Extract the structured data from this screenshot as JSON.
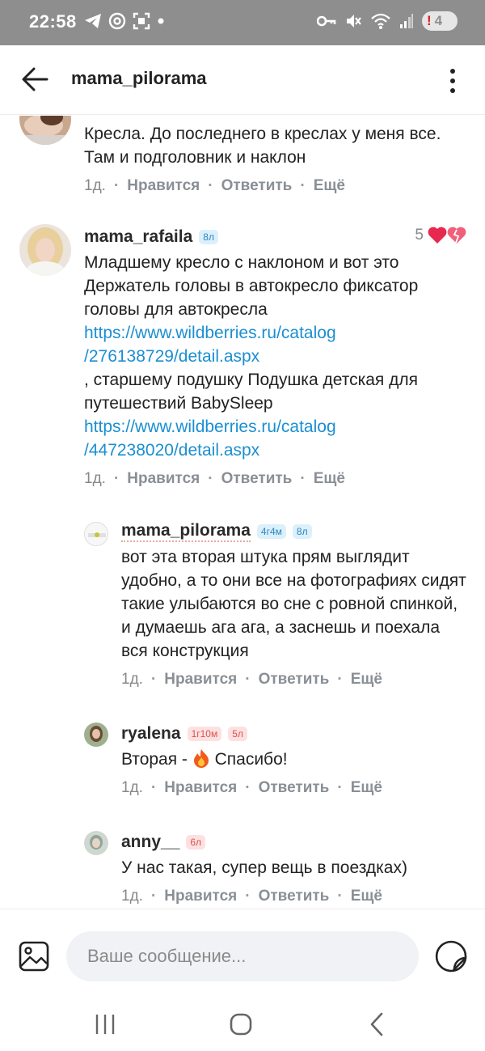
{
  "status_bar": {
    "time": "22:58",
    "battery_text": "4",
    "alert_mark": "!"
  },
  "header": {
    "title": "mama_pilorama"
  },
  "comments": [
    {
      "text": "Кресла. До последнего в креслах у меня все. Там и подголовник и наклон",
      "time": "1д.",
      "like": "Нравится",
      "reply": "Ответить",
      "more": "Ещё"
    },
    {
      "name": "mama_rafaila",
      "badges": [
        "8л"
      ],
      "likes_count": "5",
      "text_1": "Младшему кресло с наклоном и вот это Держатель головы в автокресло фиксатор головы для автокресла",
      "link_1a": "https://www.wildberries.ru/catalog",
      "link_1b": "/276138729/detail.aspx",
      "text_2": " , старшему подушку Подушка детская для путешествий BabySleep",
      "link_2a": "https://www.wildberries.ru/catalog",
      "link_2b": "/447238020/detail.aspx",
      "time": "1д.",
      "like": "Нравится",
      "reply": "Ответить",
      "more": "Ещё"
    },
    {
      "name": "mama_pilorama",
      "badges": [
        "4г4м",
        "8л"
      ],
      "text": "вот эта вторая штука прям выглядит удобно, а то они все на фотографиях сидят такие улыбаются во сне с ровной спинкой, и думаешь ага ага, а заснешь и поехала вся конструкция",
      "time": "1д.",
      "like": "Нравится",
      "reply": "Ответить",
      "more": "Ещё"
    },
    {
      "name": "ryalena",
      "badges": [
        "1г10м",
        "5л"
      ],
      "text_before": "Вторая - ",
      "text_after": " Спасибо!",
      "time": "1д.",
      "like": "Нравится",
      "reply": "Ответить",
      "more": "Ещё"
    },
    {
      "name": "anny__",
      "badges": [
        "6л"
      ],
      "text": "У нас такая, супер вещь в поездках)",
      "time": "1д.",
      "like": "Нравится",
      "reply": "Ответить",
      "more": "Ещё"
    }
  ],
  "composer": {
    "placeholder": "Ваше сообщение..."
  },
  "colors": {
    "link": "#1a8fd1",
    "status_bar": "#8e8e8e",
    "heart": "#e8294f",
    "badge_blue_bg": "#dcf0fb",
    "badge_pink_bg": "#fde1e1"
  },
  "icons": [
    "back-arrow-icon",
    "more-vertical-icon",
    "heart-icon",
    "heart-broken-icon",
    "image-icon",
    "sticker-icon",
    "fire-emoji-icon",
    "nav-recents-icon",
    "nav-home-icon",
    "nav-back-icon"
  ]
}
